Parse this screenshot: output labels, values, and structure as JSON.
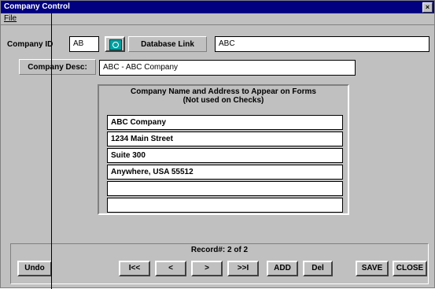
{
  "window": {
    "title": "Company Control",
    "close_glyph": "×"
  },
  "menu": {
    "file": "File"
  },
  "header": {
    "company_id_label": "Company ID",
    "company_id_value": "AB",
    "database_link_label": "Database Link",
    "database_link_value": "ABC"
  },
  "company_desc": {
    "label": "Company Desc:",
    "value": "ABC - ABC Company"
  },
  "form_address": {
    "title_line1": "Company Name and Address to Appear on Forms",
    "title_line2": "(Not used on Checks)",
    "lines": [
      "ABC Company",
      "1234 Main Street",
      "Suite 300",
      "Anywhere, USA 55512",
      "",
      ""
    ]
  },
  "footer": {
    "record_text": "Record#: 2 of 2",
    "undo": "Undo",
    "first": "I<<",
    "prev": "<",
    "next": ">",
    "last": ">>I",
    "add": "ADD",
    "del": "Del",
    "save": "SAVE",
    "close": "CLOSE"
  }
}
